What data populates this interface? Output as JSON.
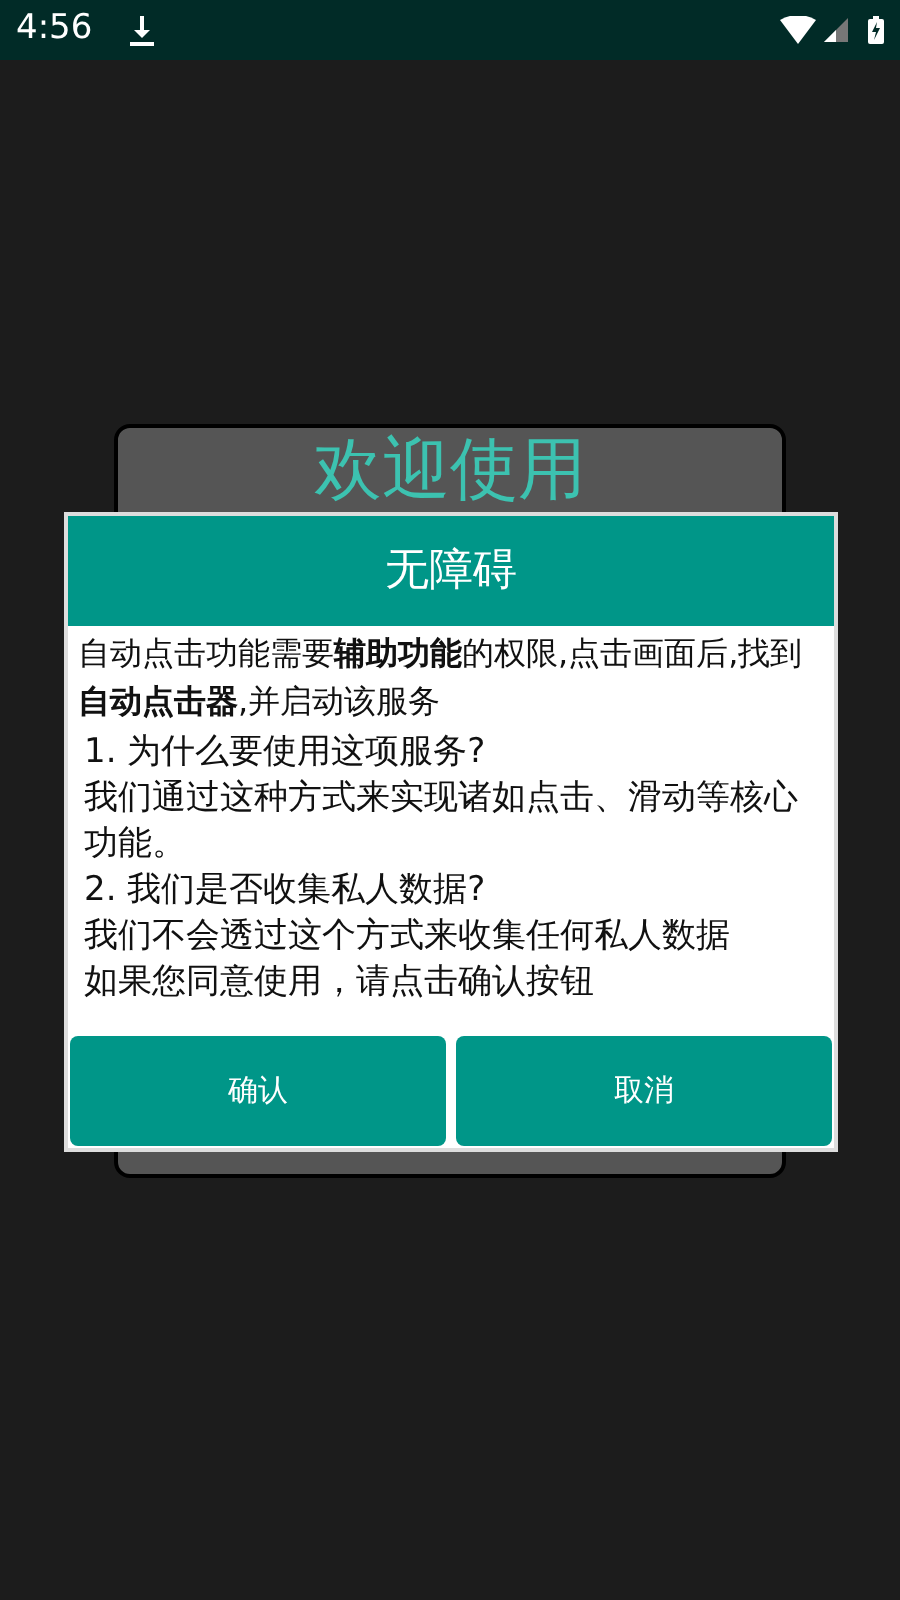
{
  "status_bar": {
    "time": "4:56"
  },
  "background_card": {
    "title": "欢迎使用"
  },
  "dialog": {
    "title": "无障碍",
    "intro": "自动点击功能需要**辅助功能**的权限,点击画面后,找到**自动点击器**,并启动该服务",
    "lines": [
      "1. 为什么要使用这项服务?",
      "我们通过这种方式来实现诸如点击、滑动等核心功能。",
      "2. 我们是否收集私人数据?",
      "我们不会透过这个方式来收集任何私人数据",
      "如果您同意使用，请点击确认按钮"
    ],
    "buttons": [
      "确认",
      "取消"
    ]
  }
}
